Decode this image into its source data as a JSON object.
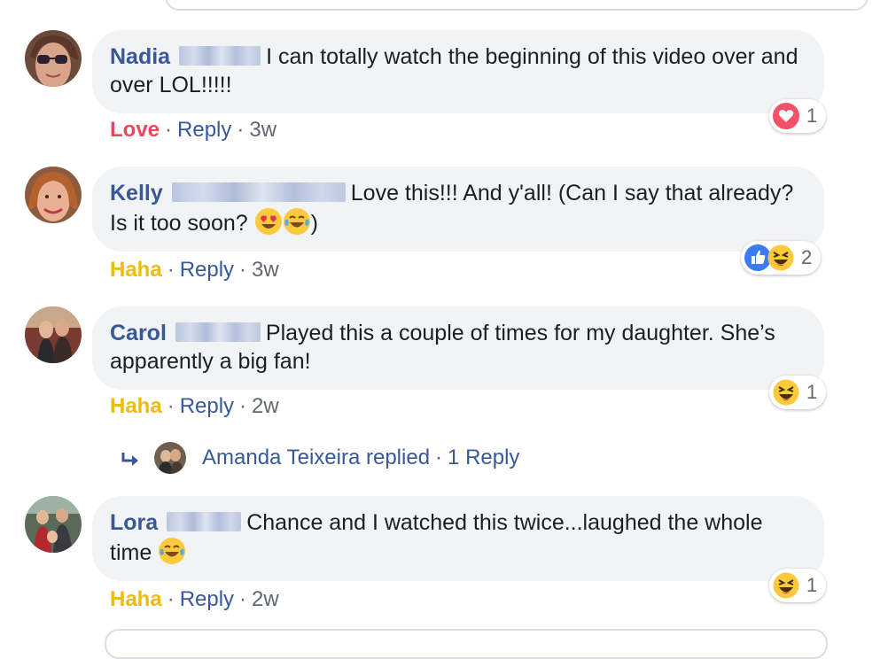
{
  "colors": {
    "author": "#385898",
    "love": "#e9475b",
    "haha": "#f0ba15",
    "meta": "#606770",
    "bubble": "#f2f3f5"
  },
  "comments": [
    {
      "author": "Nadia",
      "text": "I can totally watch the beginning of this video over and over LOL!!!!!",
      "reaction_action": "Love",
      "reply_label": "Reply",
      "time": "3w",
      "reaction_icons": [
        "love-icon"
      ],
      "reaction_count": "1"
    },
    {
      "author": "Kelly",
      "text": "Love this!!! And y'all! (Can I say that already? Is it too soon?",
      "text_end": ")",
      "inline_emojis": [
        "heart-eyes-emoji",
        "tears-of-joy-emoji"
      ],
      "reaction_action": "Haha",
      "reply_label": "Reply",
      "time": "3w",
      "reaction_icons": [
        "like-icon",
        "haha-icon"
      ],
      "reaction_count": "2"
    },
    {
      "author": "Carol",
      "text": "Played this a couple of times for my daughter. She’s apparently a big fan!",
      "reaction_action": "Haha",
      "reply_label": "Reply",
      "time": "2w",
      "reaction_icons": [
        "haha-icon"
      ],
      "reaction_count": "1",
      "replies": {
        "text": "Amanda Teixeira replied",
        "count_label": "1 Reply"
      }
    },
    {
      "author": "Lora",
      "text": "Chance and I watched this twice...laughed the whole time",
      "inline_emojis": [
        "tears-of-joy-emoji"
      ],
      "reaction_action": "Haha",
      "reply_label": "Reply",
      "time": "2w",
      "reaction_icons": [
        "haha-icon"
      ],
      "reaction_count": "1"
    }
  ]
}
